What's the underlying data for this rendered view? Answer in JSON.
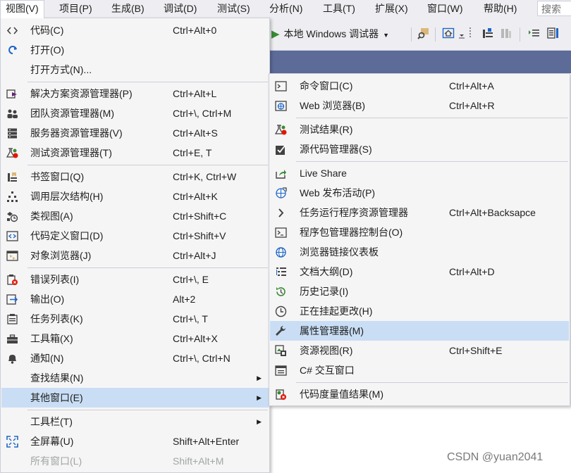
{
  "menubar": {
    "items": [
      "视图(V)",
      "项目(P)",
      "生成(B)",
      "调试(D)",
      "测试(S)",
      "分析(N)",
      "工具(T)",
      "扩展(X)",
      "窗口(W)",
      "帮助(H)"
    ],
    "search_label": "搜索"
  },
  "toolbar": {
    "debug_target": "本地 Windows 调试器"
  },
  "view_menu": {
    "items": [
      {
        "label": "代码(C)",
        "shortcut": "Ctrl+Alt+0",
        "icon": "code-icon"
      },
      {
        "label": "打开(O)",
        "shortcut": "",
        "icon": "open-arrow-icon"
      },
      {
        "label": "打开方式(N)...",
        "shortcut": "",
        "icon": ""
      },
      {
        "label": "解决方案资源管理器(P)",
        "shortcut": "Ctrl+Alt+L",
        "icon": "solution-explorer-icon"
      },
      {
        "label": "团队资源管理器(M)",
        "shortcut": "Ctrl+\\, Ctrl+M",
        "icon": "team-explorer-icon"
      },
      {
        "label": "服务器资源管理器(V)",
        "shortcut": "Ctrl+Alt+S",
        "icon": "server-explorer-icon"
      },
      {
        "label": "测试资源管理器(T)",
        "shortcut": "Ctrl+E, T",
        "icon": "test-explorer-icon"
      },
      {
        "label": "书签窗口(Q)",
        "shortcut": "Ctrl+K, Ctrl+W",
        "icon": "bookmark-icon"
      },
      {
        "label": "调用层次结构(H)",
        "shortcut": "Ctrl+Alt+K",
        "icon": "call-hierarchy-icon"
      },
      {
        "label": "类视图(A)",
        "shortcut": "Ctrl+Shift+C",
        "icon": "class-view-icon"
      },
      {
        "label": "代码定义窗口(D)",
        "shortcut": "Ctrl+Shift+V",
        "icon": "code-definition-icon"
      },
      {
        "label": "对象浏览器(J)",
        "shortcut": "Ctrl+Alt+J",
        "icon": "object-browser-icon"
      },
      {
        "label": "错误列表(I)",
        "shortcut": "Ctrl+\\, E",
        "icon": "error-list-icon"
      },
      {
        "label": "输出(O)",
        "shortcut": "Alt+2",
        "icon": "output-icon"
      },
      {
        "label": "任务列表(K)",
        "shortcut": "Ctrl+\\, T",
        "icon": "task-list-icon"
      },
      {
        "label": "工具箱(X)",
        "shortcut": "Ctrl+Alt+X",
        "icon": "toolbox-icon"
      },
      {
        "label": "通知(N)",
        "shortcut": "Ctrl+\\, Ctrl+N",
        "icon": "bell-icon"
      },
      {
        "label": "查找结果(N)",
        "shortcut": "",
        "icon": ""
      },
      {
        "label": "其他窗口(E)",
        "shortcut": "",
        "icon": ""
      },
      {
        "label": "工具栏(T)",
        "shortcut": "",
        "icon": ""
      },
      {
        "label": "全屏幕(U)",
        "shortcut": "Shift+Alt+Enter",
        "icon": "fullscreen-icon"
      },
      {
        "label": "所有窗口(L)",
        "shortcut": "Shift+Alt+M",
        "icon": ""
      }
    ]
  },
  "other_windows_menu": {
    "items": [
      {
        "label": "命令窗口(C)",
        "shortcut": "Ctrl+Alt+A",
        "icon": "command-window-icon"
      },
      {
        "label": "Web 浏览器(B)",
        "shortcut": "Ctrl+Alt+R",
        "icon": "web-browser-icon"
      },
      {
        "label": "测试结果(R)",
        "shortcut": "",
        "icon": "test-results-icon"
      },
      {
        "label": "源代码管理器(S)",
        "shortcut": "",
        "icon": "source-control-icon"
      },
      {
        "label": "Live Share",
        "shortcut": "",
        "icon": "live-share-icon"
      },
      {
        "label": "Web 发布活动(P)",
        "shortcut": "",
        "icon": "web-publish-icon"
      },
      {
        "label": "任务运行程序资源管理器",
        "shortcut": "Ctrl+Alt+Backsapce",
        "icon": "chevron-right-icon"
      },
      {
        "label": "程序包管理器控制台(O)",
        "shortcut": "",
        "icon": "package-console-icon"
      },
      {
        "label": "浏览器链接仪表板",
        "shortcut": "",
        "icon": "browser-link-icon"
      },
      {
        "label": "文档大纲(D)",
        "shortcut": "Ctrl+Alt+D",
        "icon": "document-outline-icon"
      },
      {
        "label": "历史记录(I)",
        "shortcut": "",
        "icon": "history-icon"
      },
      {
        "label": "正在挂起更改(H)",
        "shortcut": "",
        "icon": "clock-icon"
      },
      {
        "label": "属性管理器(M)",
        "shortcut": "",
        "icon": "wrench-icon"
      },
      {
        "label": "资源视图(R)",
        "shortcut": "Ctrl+Shift+E",
        "icon": "resource-view-icon"
      },
      {
        "label": "C# 交互窗口",
        "shortcut": "",
        "icon": "csharp-interactive-icon"
      },
      {
        "label": "代码度量值结果(M)",
        "shortcut": "",
        "icon": "code-metrics-icon"
      }
    ]
  },
  "watermark": "CSDN @yuan2041"
}
